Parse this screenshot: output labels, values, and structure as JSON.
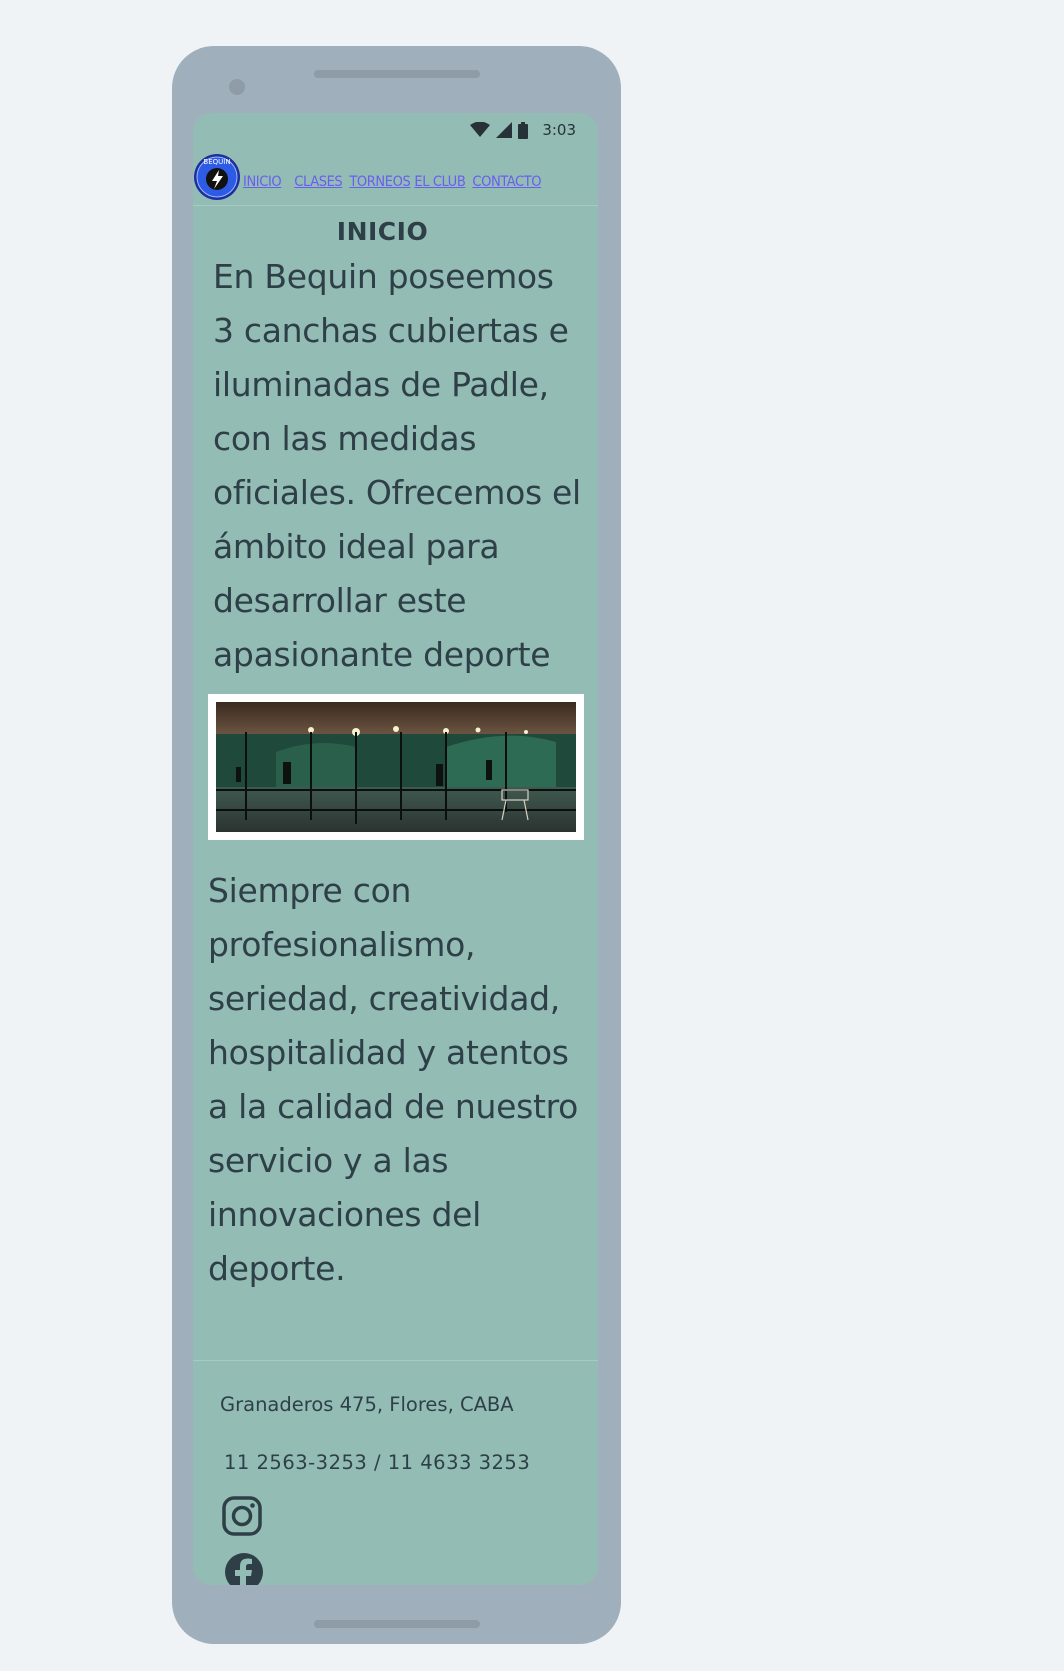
{
  "status_bar": {
    "time": "3:03",
    "icons": [
      "wifi-icon",
      "signal-icon",
      "battery-icon"
    ]
  },
  "nav": {
    "logo_text": "BEQUIN",
    "links": [
      "INICIO",
      "CLASES",
      "TORNEOS",
      "EL CLUB",
      "CONTACTO"
    ]
  },
  "main": {
    "heading": "INICIO",
    "paragraph_1": "En Bequin poseemos 3 canchas cubiertas e iluminadas de Padle, con las medidas oficiales. Ofrecemos el ámbito ideal para desarrollar este apasionante deporte",
    "paragraph_2": "Siempre con profesionalismo, seriedad, creatividad, hospitalidad y atentos a la calidad de nuestro servicio y a las innovaciones del deporte."
  },
  "footer": {
    "address": "Granaderos 475, Flores, CABA",
    "phone": "11 2563-3253 / 11 4633 3253",
    "social_icons": [
      "instagram-icon",
      "facebook-icon"
    ]
  },
  "colors": {
    "page_background": "#eff3f6",
    "device_frame": "#9fafbc",
    "screen_background": "#93bdb4",
    "text": "#2e3f48",
    "link": "#6a5df0"
  }
}
